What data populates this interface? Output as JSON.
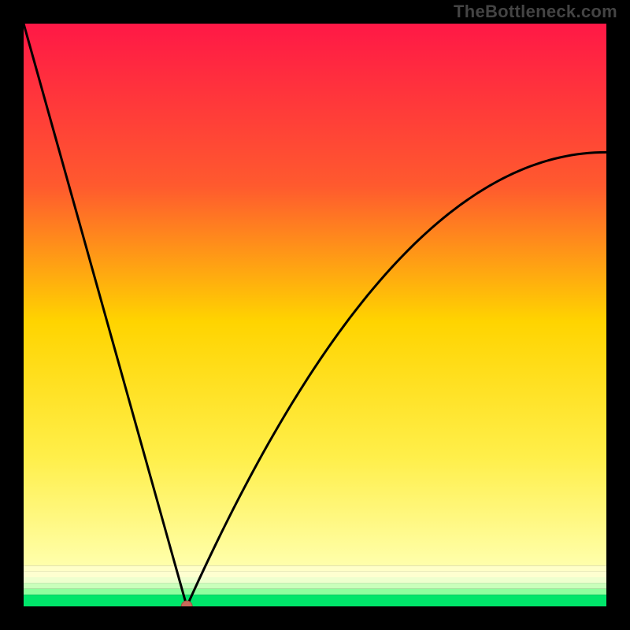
{
  "watermark": "TheBottleneck.com",
  "colors": {
    "bg_black": "#000000",
    "curve": "#000000",
    "marker_fill": "#c86a5a",
    "marker_stroke": "#a04d3f",
    "grad_top": "#ff1846",
    "grad_mid1": "#ff7a2a",
    "grad_mid2": "#ffd400",
    "grad_mid3": "#ffff66",
    "grad_mid4": "#ffffab",
    "grad_bottom": "#00e66a"
  },
  "chart_data": {
    "type": "line",
    "title": "",
    "xlabel": "",
    "ylabel": "",
    "xlim": [
      0,
      100
    ],
    "ylim": [
      0,
      100
    ],
    "x": [
      0,
      1,
      2,
      3,
      4,
      5,
      6,
      7,
      8,
      9,
      10,
      11,
      12,
      13,
      14,
      15,
      16,
      17,
      18,
      19,
      20,
      21,
      22,
      23,
      24,
      25,
      26,
      27,
      28,
      29,
      30,
      31,
      32,
      33,
      34,
      35,
      36,
      37,
      38,
      39,
      40,
      41,
      42,
      43,
      44,
      45,
      46,
      47,
      48,
      49,
      50,
      51,
      52,
      53,
      54,
      55,
      56,
      57,
      58,
      59,
      60,
      61,
      62,
      63,
      64,
      65,
      66,
      67,
      68,
      69,
      70,
      71,
      72,
      73,
      74,
      75,
      76,
      77,
      78,
      79,
      80,
      81,
      82,
      83,
      84,
      85,
      86,
      87,
      88,
      89,
      90,
      91,
      92,
      93,
      94,
      95,
      96,
      97,
      98,
      99,
      100
    ],
    "values": [
      100.0,
      96.43,
      92.86,
      89.29,
      85.71,
      82.14,
      78.57,
      75.0,
      71.43,
      67.86,
      64.29,
      60.71,
      57.14,
      53.57,
      50.0,
      46.43,
      42.86,
      39.29,
      35.71,
      32.14,
      28.57,
      25.0,
      21.43,
      17.86,
      14.29,
      10.71,
      7.14,
      3.57,
      0.0,
      2.21,
      4.39,
      6.53,
      8.64,
      10.72,
      12.77,
      14.78,
      16.76,
      18.71,
      20.62,
      22.5,
      24.35,
      26.17,
      27.95,
      29.7,
      31.42,
      33.11,
      34.76,
      36.38,
      37.97,
      39.53,
      41.06,
      42.55,
      44.01,
      45.44,
      46.84,
      48.2,
      49.54,
      50.84,
      52.11,
      53.35,
      54.55,
      55.73,
      56.87,
      57.99,
      59.07,
      60.12,
      61.14,
      62.13,
      63.09,
      64.01,
      64.91,
      65.78,
      66.61,
      67.42,
      68.19,
      68.94,
      69.65,
      70.33,
      70.99,
      71.61,
      72.21,
      72.77,
      73.31,
      73.81,
      74.29,
      74.73,
      75.15,
      75.54,
      75.89,
      76.22,
      76.52,
      76.79,
      77.03,
      77.24,
      77.43,
      77.58,
      77.71,
      77.8,
      77.87,
      77.91,
      77.92
    ],
    "marker": {
      "x": 28,
      "y": 0
    },
    "background_bands": [
      {
        "from": 100,
        "to": 7,
        "kind": "gradient",
        "top": "#ff1846",
        "bottom": "#ffffab"
      },
      {
        "from": 7,
        "to": 6,
        "kind": "solid",
        "color": "#ffffc8"
      },
      {
        "from": 6,
        "to": 5,
        "kind": "solid",
        "color": "#feffd0"
      },
      {
        "from": 5,
        "to": 4,
        "kind": "solid",
        "color": "#eeffce"
      },
      {
        "from": 4,
        "to": 3,
        "kind": "solid",
        "color": "#c9ffbb"
      },
      {
        "from": 3,
        "to": 2,
        "kind": "solid",
        "color": "#8fff9e"
      },
      {
        "from": 2,
        "to": 0,
        "kind": "solid",
        "color": "#00e66a"
      }
    ]
  }
}
